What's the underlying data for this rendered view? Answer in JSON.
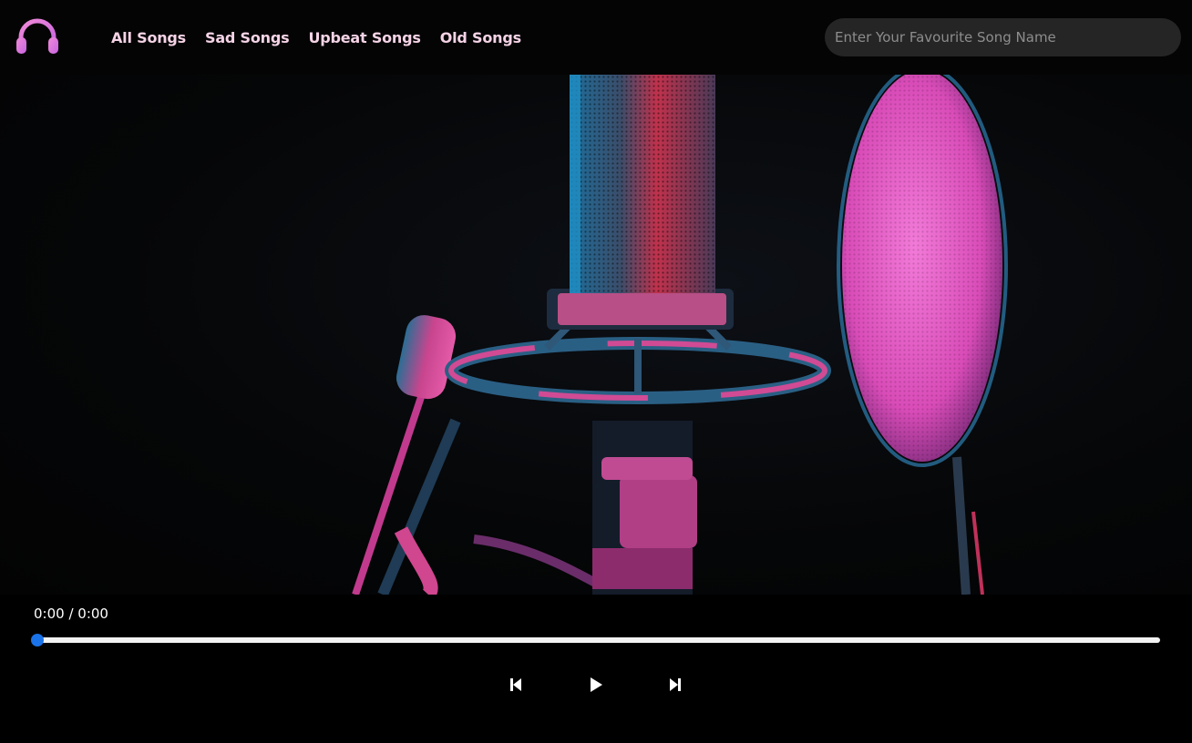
{
  "nav": {
    "logo_icon": "headphones-icon",
    "logo_color": "#e27bd8",
    "links": [
      {
        "label": "All Songs"
      },
      {
        "label": "Sad Songs"
      },
      {
        "label": "Upbeat Songs"
      },
      {
        "label": "Old Songs"
      }
    ],
    "link_color": "#f5d3e6"
  },
  "search": {
    "placeholder": "Enter Your Favourite Song Name",
    "value": ""
  },
  "hero": {
    "image_icon": "microphone-image"
  },
  "player": {
    "time": "0:00 / 0:00",
    "progress_fraction": 0,
    "accent_color": "#1a73e8",
    "controls": {
      "previous_icon": "skip-previous-icon",
      "play_icon": "play-icon",
      "next_icon": "skip-next-icon"
    }
  }
}
